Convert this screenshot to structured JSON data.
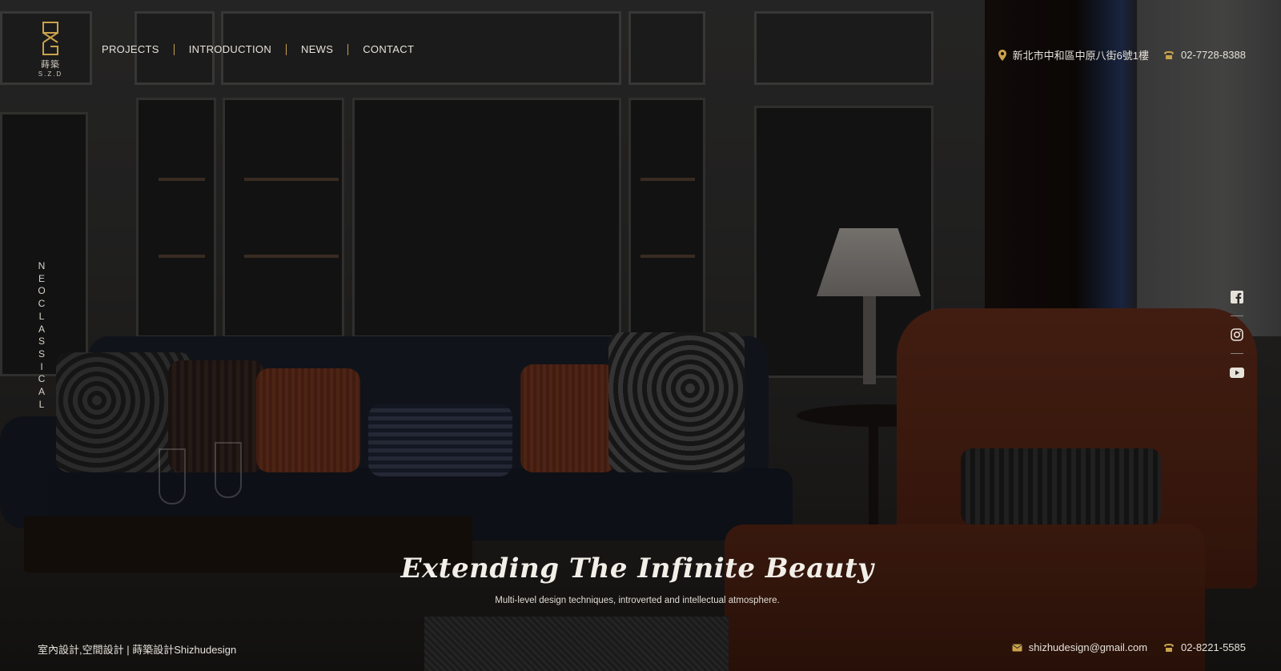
{
  "brand": {
    "name_zh": "蒔築",
    "name_en": "S.Z.D",
    "accent": "#c9a24c"
  },
  "nav": {
    "items": [
      {
        "label": "PROJECTS"
      },
      {
        "label": "INTRODUCTION"
      },
      {
        "label": "NEWS"
      },
      {
        "label": "CONTACT"
      }
    ],
    "separator_color": "#c9a24c"
  },
  "header_contact": {
    "address": "新北市中和區中原八街6號1樓",
    "address_icon": "map-pin-icon",
    "phone": "02-7728-8388",
    "phone_icon": "phone-icon"
  },
  "side_label": {
    "letters": [
      "N",
      "E",
      "O",
      "C",
      "L",
      "A",
      "S",
      "S",
      "I",
      "C",
      "A",
      "L"
    ]
  },
  "social": [
    {
      "icon": "facebook-icon"
    },
    {
      "icon": "instagram-icon"
    },
    {
      "icon": "youtube-icon"
    }
  ],
  "hero": {
    "title": "Extending The Infinite Beauty",
    "subtitle": "Multi-level design techniques, introverted and intellectual atmosphere."
  },
  "footer": {
    "left_text": "室內設計,空間設計 | 蒔築設計Shizhudesign",
    "email": "shizhudesign@gmail.com",
    "email_icon": "mail-icon",
    "phone": "02-8221-5585",
    "phone_icon": "phone-icon"
  }
}
